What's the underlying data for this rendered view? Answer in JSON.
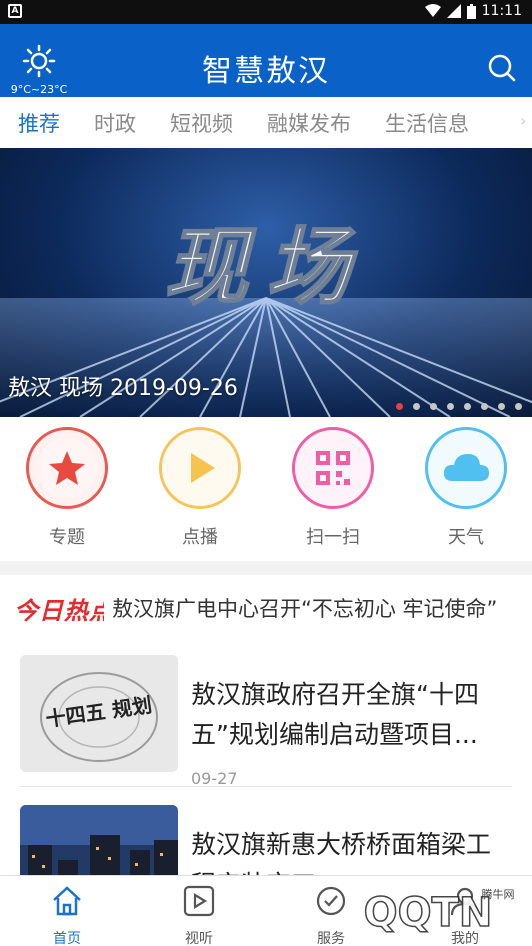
{
  "status_bar": {
    "time": "11:11"
  },
  "header": {
    "title": "智慧敖汉",
    "weather_temp": "9°C~23°C"
  },
  "tabs": [
    {
      "label": "推荐",
      "active": true
    },
    {
      "label": "时政",
      "active": false
    },
    {
      "label": "短视频",
      "active": false
    },
    {
      "label": "融媒发布",
      "active": false
    },
    {
      "label": "生活信息",
      "active": false
    }
  ],
  "banner": {
    "image_text": "现场",
    "caption": "敖汉 现场 2019-09-26",
    "slide_count": 8,
    "active_slide": 1
  },
  "shortcuts": [
    {
      "label": "专题",
      "icon": "star-icon",
      "color": "#e85a4f"
    },
    {
      "label": "点播",
      "icon": "play-icon",
      "color": "#f5c55b"
    },
    {
      "label": "扫一扫",
      "icon": "qr-icon",
      "color": "#ef5ea5"
    },
    {
      "label": "天气",
      "icon": "cloud-icon",
      "color": "#52c0ef"
    }
  ],
  "hot": {
    "tag": "今日热点",
    "headline": "敖汉旗广电中心召开“不忘初心 牢记使命”"
  },
  "news": [
    {
      "title": "敖汉旗政府召开全旗“十四五”规划编制启动暨项目...",
      "date": "09-27",
      "thumb_text": "十四五 规划"
    },
    {
      "title": "敖汉旗新惠大桥桥面箱梁工程安装完工",
      "date": ""
    }
  ],
  "bottom_nav": [
    {
      "label": "首页",
      "icon": "home-icon",
      "active": true
    },
    {
      "label": "视听",
      "icon": "video-icon",
      "active": false
    },
    {
      "label": "服务",
      "icon": "service-icon",
      "active": false
    },
    {
      "label": "我的",
      "icon": "user-icon",
      "active": false
    }
  ],
  "watermark": {
    "text": "QQTN",
    "subtext": "腾牛网"
  },
  "colors": {
    "primary": "#0a62c9",
    "accent": "#e32b2b",
    "tab_active": "#1a73c8"
  }
}
